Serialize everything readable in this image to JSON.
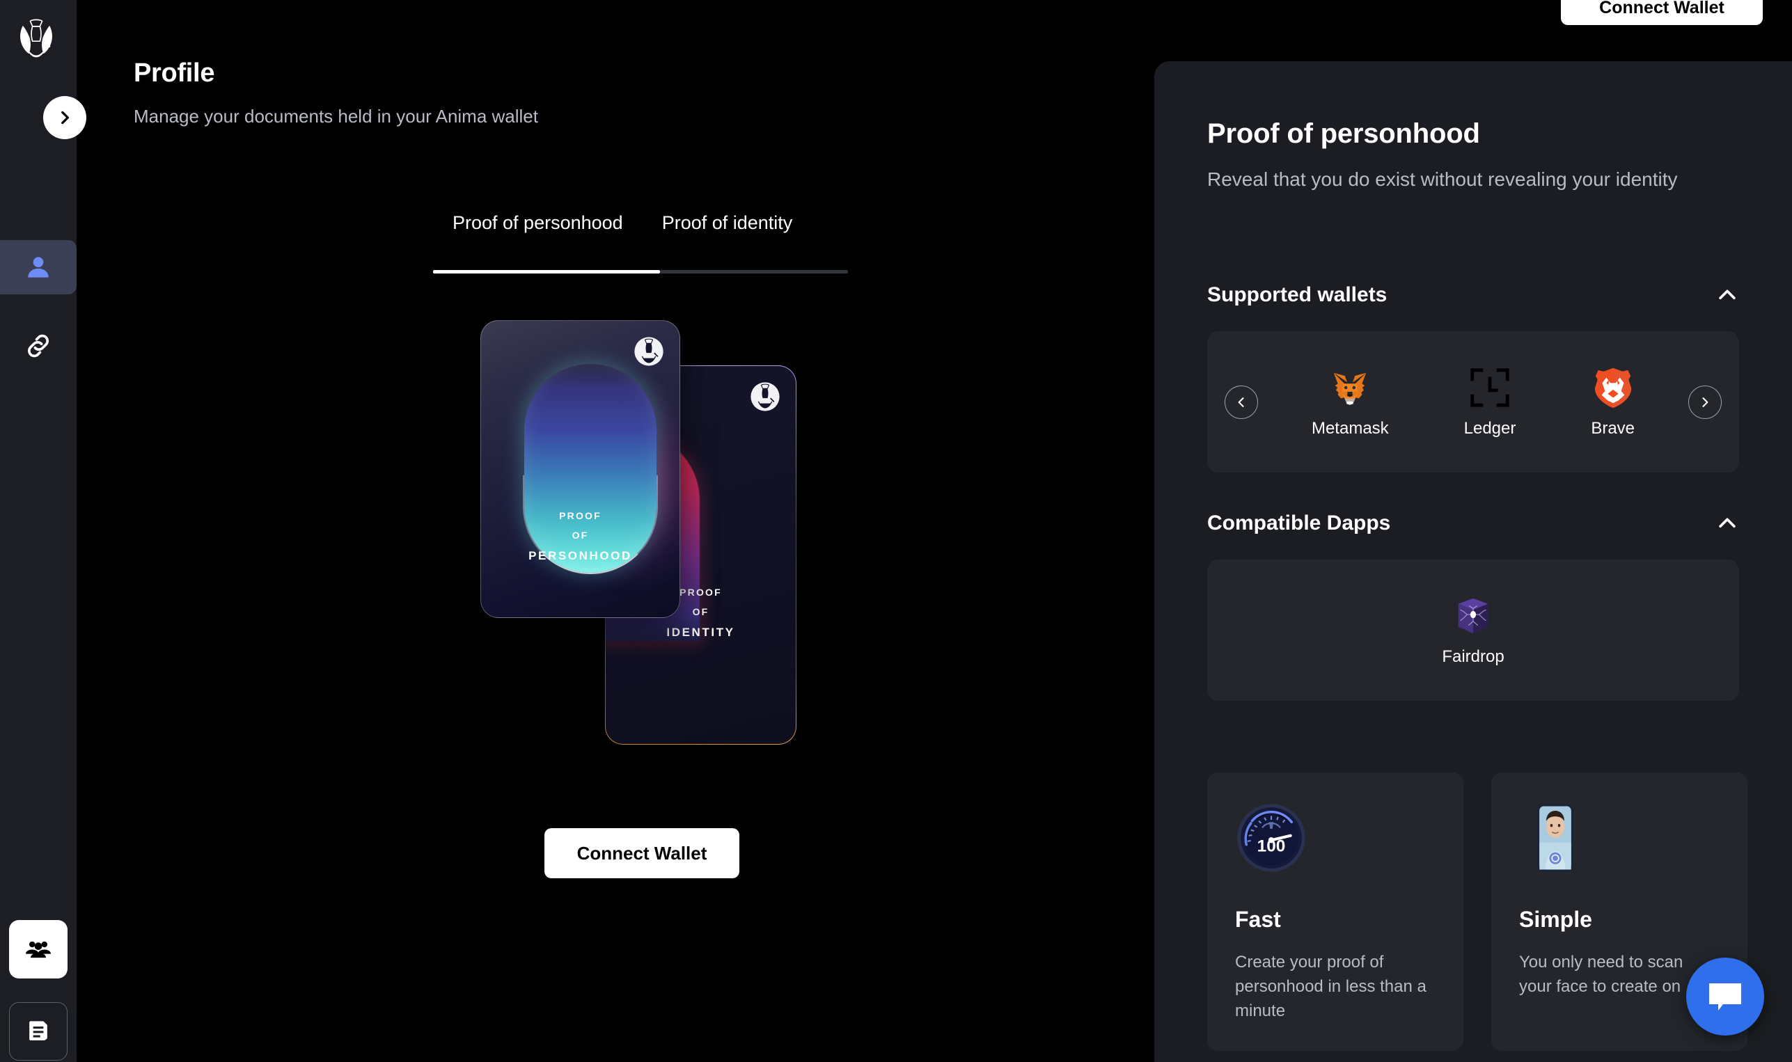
{
  "brand": {
    "logo_icon": "anima-logo-icon"
  },
  "sidebar": {
    "toggle_icon": "chevron-right-icon",
    "items": [
      {
        "icon": "person-icon",
        "name": "profile",
        "active": true
      },
      {
        "icon": "link-chain-icon",
        "name": "connections",
        "active": false
      }
    ],
    "bottom_items": [
      {
        "icon": "people-group-icon",
        "name": "community",
        "style": "filled"
      },
      {
        "icon": "document-icon",
        "name": "docs",
        "style": "outlined"
      }
    ]
  },
  "header": {
    "title": "Profile",
    "subtitle": "Manage your documents held in your Anima wallet",
    "connect_wallet_label": "Connect Wallet"
  },
  "tabs": [
    {
      "label": "Proof of personhood",
      "active": true
    },
    {
      "label": "Proof of identity",
      "active": false
    }
  ],
  "cards": {
    "front": {
      "line1": "PROOF",
      "line2": "OF",
      "line3": "PERSONHOOD",
      "logo_icon": "anima-logo-icon"
    },
    "back": {
      "line1": "PROOF",
      "line2": "OF",
      "line3": "IDENTITY",
      "logo_icon": "anima-logo-icon"
    }
  },
  "main_cta": {
    "label": "Connect Wallet"
  },
  "panel": {
    "title": "Proof of personhood",
    "subtitle": "Reveal that you do exist without revealing your identity",
    "sections": [
      {
        "title": "Supported wallets",
        "chevron_icon": "chevron-up-icon",
        "expanded": true
      },
      {
        "title": "Compatible Dapps",
        "chevron_icon": "chevron-up-icon",
        "expanded": true
      }
    ],
    "wallets": {
      "prev_icon": "chevron-left-icon",
      "next_icon": "chevron-right-icon",
      "items": [
        {
          "label": "Metamask",
          "icon": "metamask-fox-icon"
        },
        {
          "label": "Ledger",
          "icon": "ledger-icon"
        },
        {
          "label": "Brave",
          "icon": "brave-lion-icon"
        }
      ]
    },
    "dapps": [
      {
        "label": "Fairdrop",
        "icon": "fairdrop-cube-icon"
      }
    ],
    "features": [
      {
        "title": "Fast",
        "description": "Create your proof of personhood in less than a minute",
        "icon": "speedometer-icon",
        "icon_value": "100"
      },
      {
        "title": "Simple",
        "description": "You only need to scan your face to create on",
        "icon": "face-scan-phone-icon"
      }
    ]
  },
  "chat": {
    "icon": "chat-bubble-icon",
    "color": "#2f6fec"
  },
  "colors": {
    "background": "#000000",
    "sidebar": "#1d1e23",
    "panel": "#1c1d22",
    "card_surface": "#24262c",
    "accent_active": "#6e8cf5",
    "text_primary": "#ffffff",
    "text_muted": "#b9bcc6"
  }
}
